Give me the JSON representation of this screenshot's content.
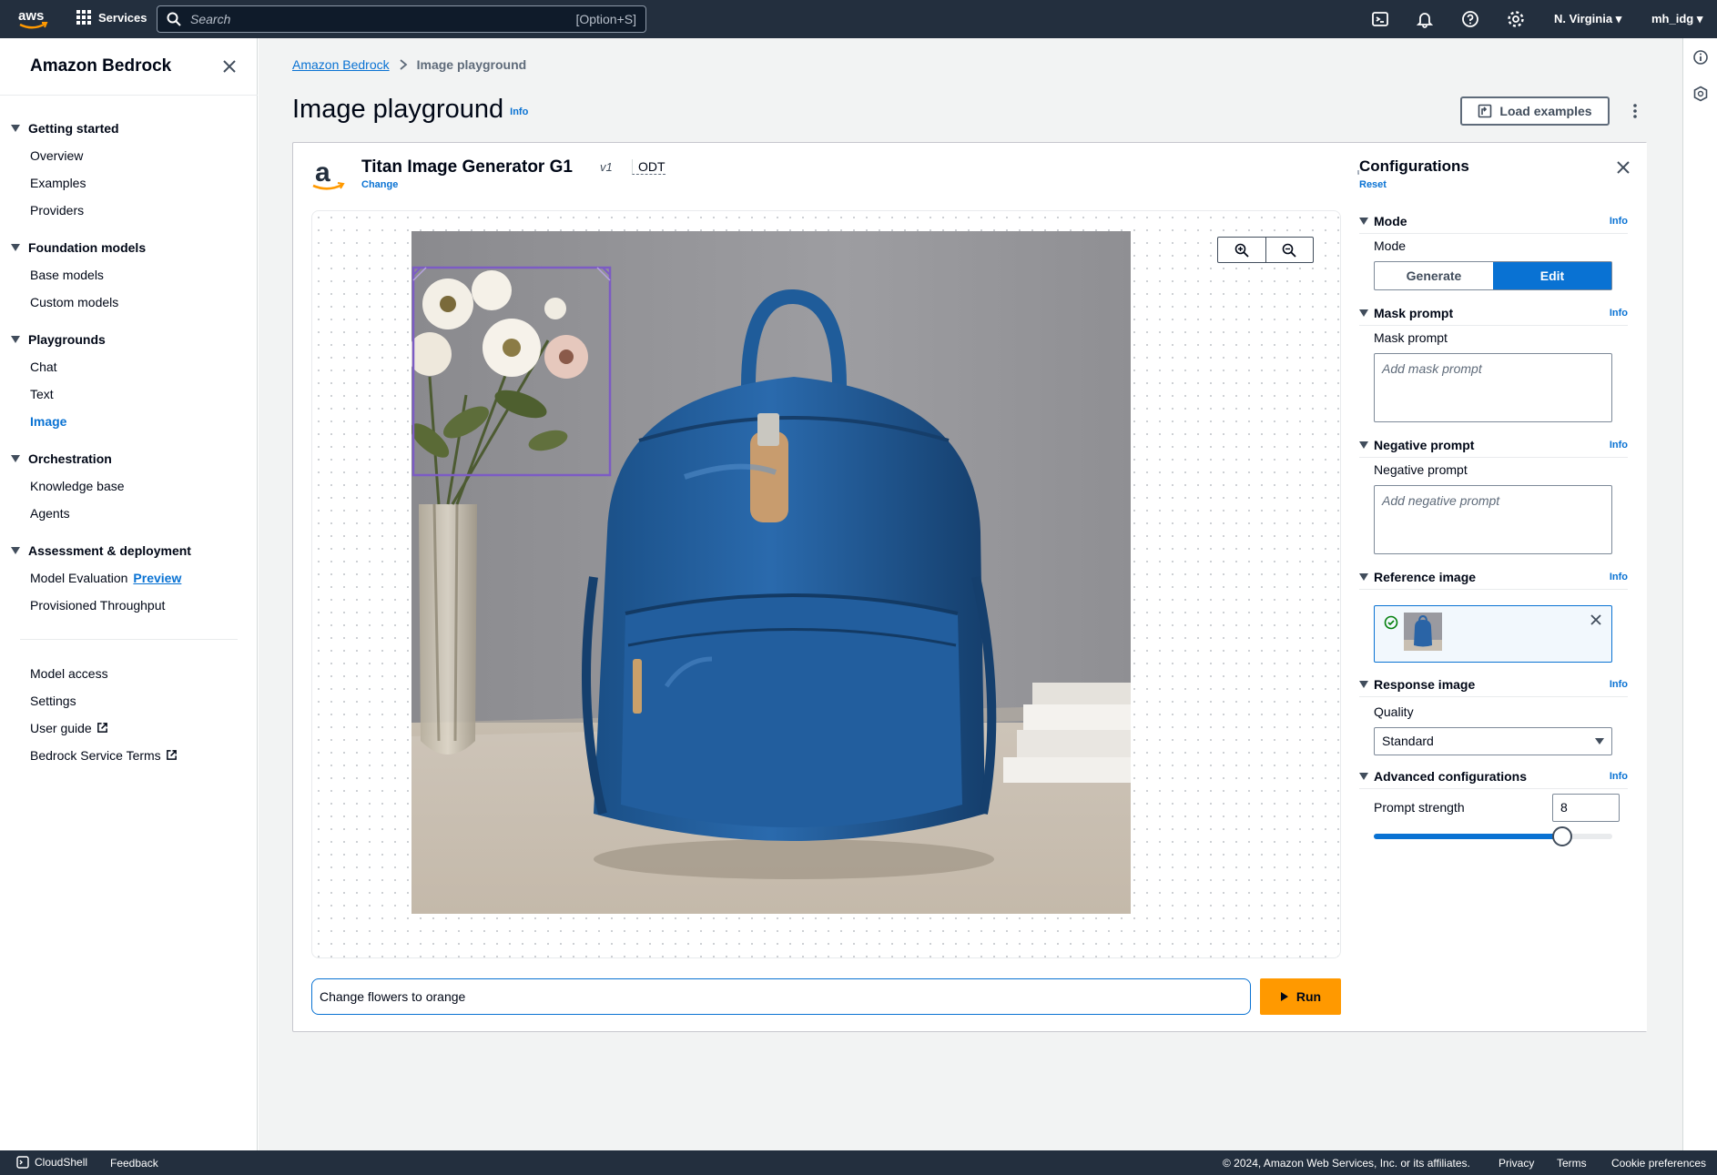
{
  "topbar": {
    "logo_text": "aws",
    "services_label": "Services",
    "search_placeholder": "Search",
    "search_shortcut": "[Option+S]",
    "region": "N. Virginia",
    "user": "mh_idg",
    "icons": [
      "cloudshell-icon",
      "bell-icon",
      "help-icon",
      "settings-icon"
    ]
  },
  "sidebar": {
    "title": "Amazon Bedrock",
    "groups": [
      {
        "label": "Getting started",
        "items": [
          "Overview",
          "Examples",
          "Providers"
        ]
      },
      {
        "label": "Foundation models",
        "items": [
          "Base models",
          "Custom models"
        ]
      },
      {
        "label": "Playgrounds",
        "items": [
          "Chat",
          "Text",
          "Image"
        ]
      },
      {
        "label": "Orchestration",
        "items": [
          "Knowledge base",
          "Agents"
        ]
      },
      {
        "label": "Assessment & deployment",
        "items": [
          "Model Evaluation",
          "Provisioned Throughput"
        ]
      }
    ],
    "preview_badge": "Preview",
    "active_item": "Image",
    "bottom_items": [
      "Model access",
      "Settings",
      "User guide",
      "Bedrock Service Terms"
    ]
  },
  "breadcrumb": {
    "root": "Amazon Bedrock",
    "current": "Image playground"
  },
  "page": {
    "title": "Image playground",
    "info": "Info",
    "load_examples": "Load examples"
  },
  "model": {
    "name": "Titan Image Generator G1",
    "version": "v1",
    "throughput": "ODT",
    "change": "Change"
  },
  "prompt": {
    "value": "Change flowers to orange",
    "run_label": "Run"
  },
  "config": {
    "title": "Configurations",
    "reset": "Reset",
    "info": "Info",
    "mode": {
      "section": "Mode",
      "label": "Mode",
      "options": [
        "Generate",
        "Edit"
      ],
      "selected": "Edit"
    },
    "mask": {
      "section": "Mask prompt",
      "label": "Mask prompt",
      "placeholder": "Add mask prompt"
    },
    "negative": {
      "section": "Negative prompt",
      "label": "Negative prompt",
      "placeholder": "Add negative prompt"
    },
    "reference": {
      "section": "Reference image"
    },
    "response": {
      "section": "Response image",
      "label": "Quality",
      "value": "Standard"
    },
    "advanced": {
      "section": "Advanced configurations",
      "label": "Prompt strength",
      "value": "8",
      "slider_fraction": 0.79
    }
  },
  "footer": {
    "cloudshell": "CloudShell",
    "feedback": "Feedback",
    "copyright": "© 2024, Amazon Web Services, Inc. or its affiliates.",
    "privacy": "Privacy",
    "terms": "Terms",
    "cookies": "Cookie preferences"
  },
  "colors": {
    "accent": "#0972d3",
    "run": "#ff9900",
    "topbar": "#232f3e",
    "backpack": "#1f5c9a"
  }
}
